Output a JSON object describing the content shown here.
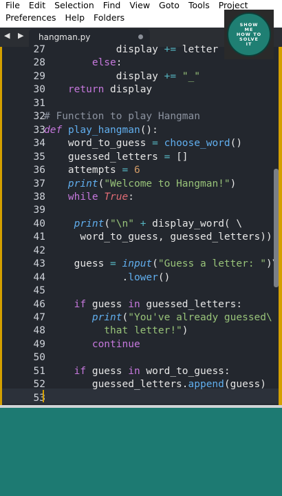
{
  "menu": {
    "row1": [
      "File",
      "Edit",
      "Selection",
      "Find",
      "View",
      "Goto",
      "Tools",
      "Project"
    ],
    "row2": [
      "Preferences",
      "Help",
      "Folders"
    ]
  },
  "logo": {
    "lines": [
      "SHOW",
      "ME",
      "HOW TO",
      "SOLVE",
      "IT"
    ]
  },
  "tab": {
    "nav": "◀ ▶",
    "title": "hangman.py"
  },
  "colors": {
    "accent": "#d4a000",
    "editor_bg": "#23272e",
    "bottom_bg": "#1d7a72"
  },
  "lines": [
    {
      "num": "27",
      "tokens": [
        {
          "t": "            display ",
          "c": "plain"
        },
        {
          "t": "+=",
          "c": "op"
        },
        {
          "t": " letter",
          "c": "plain"
        }
      ]
    },
    {
      "num": "28",
      "tokens": [
        {
          "t": "        else",
          "c": "kw"
        },
        {
          "t": ":",
          "c": "plain"
        }
      ]
    },
    {
      "num": "29",
      "tokens": [
        {
          "t": "            display ",
          "c": "plain"
        },
        {
          "t": "+=",
          "c": "op"
        },
        {
          "t": " ",
          "c": "plain"
        },
        {
          "t": "\"_\"",
          "c": "str"
        }
      ]
    },
    {
      "num": "30",
      "tokens": [
        {
          "t": "    return",
          "c": "kw"
        },
        {
          "t": " display",
          "c": "plain"
        }
      ]
    },
    {
      "num": "31",
      "tokens": []
    },
    {
      "num": "32",
      "tokens": [
        {
          "t": "# Function to play Hangman",
          "c": "cmt"
        }
      ]
    },
    {
      "num": "33",
      "tokens": [
        {
          "t": "def",
          "c": "def"
        },
        {
          "t": " ",
          "c": "plain"
        },
        {
          "t": "play_hangman",
          "c": "fn"
        },
        {
          "t": "():",
          "c": "plain"
        }
      ]
    },
    {
      "num": "34",
      "tokens": [
        {
          "t": "    word_to_guess ",
          "c": "plain"
        },
        {
          "t": "=",
          "c": "op"
        },
        {
          "t": " ",
          "c": "plain"
        },
        {
          "t": "choose_word",
          "c": "fn"
        },
        {
          "t": "()",
          "c": "plain"
        }
      ]
    },
    {
      "num": "35",
      "tokens": [
        {
          "t": "    guessed_letters ",
          "c": "plain"
        },
        {
          "t": "=",
          "c": "op"
        },
        {
          "t": " []",
          "c": "plain"
        }
      ]
    },
    {
      "num": "36",
      "tokens": [
        {
          "t": "    attempts ",
          "c": "plain"
        },
        {
          "t": "=",
          "c": "op"
        },
        {
          "t": " ",
          "c": "plain"
        },
        {
          "t": "6",
          "c": "num"
        }
      ]
    },
    {
      "num": "37",
      "tokens": [
        {
          "t": "    print",
          "c": "fnitalic"
        },
        {
          "t": "(",
          "c": "plain"
        },
        {
          "t": "\"Welcome to Hangman!\"",
          "c": "str"
        },
        {
          "t": ")",
          "c": "plain"
        }
      ]
    },
    {
      "num": "38",
      "tokens": [
        {
          "t": "    while",
          "c": "kw"
        },
        {
          "t": " ",
          "c": "plain"
        },
        {
          "t": "True",
          "c": "true"
        },
        {
          "t": ":",
          "c": "plain"
        }
      ]
    },
    {
      "num": "39",
      "tokens": []
    },
    {
      "num": "40",
      "tokens": [
        {
          "t": "     print",
          "c": "fnitalic"
        },
        {
          "t": "(",
          "c": "plain"
        },
        {
          "t": "\"\\n\"",
          "c": "str"
        },
        {
          "t": " ",
          "c": "plain"
        },
        {
          "t": "+",
          "c": "op"
        },
        {
          "t": " display_word( \\",
          "c": "plain"
        }
      ]
    },
    {
      "num": "41",
      "tokens": [
        {
          "t": "      word_to_guess, guessed_letters))",
          "c": "plain"
        }
      ]
    },
    {
      "num": "42",
      "tokens": []
    },
    {
      "num": "43",
      "tokens": [
        {
          "t": "     guess ",
          "c": "plain"
        },
        {
          "t": "=",
          "c": "op"
        },
        {
          "t": " ",
          "c": "plain"
        },
        {
          "t": "input",
          "c": "fnitalic"
        },
        {
          "t": "(",
          "c": "plain"
        },
        {
          "t": "\"Guess a letter: \"",
          "c": "str"
        },
        {
          "t": ")\\",
          "c": "plain"
        }
      ]
    },
    {
      "num": "44",
      "tokens": [
        {
          "t": "             .",
          "c": "plain"
        },
        {
          "t": "lower",
          "c": "fn"
        },
        {
          "t": "()",
          "c": "plain"
        }
      ]
    },
    {
      "num": "45",
      "tokens": []
    },
    {
      "num": "46",
      "tokens": [
        {
          "t": "     if",
          "c": "kw"
        },
        {
          "t": " guess ",
          "c": "plain"
        },
        {
          "t": "in",
          "c": "kw"
        },
        {
          "t": " guessed_letters:",
          "c": "plain"
        }
      ]
    },
    {
      "num": "47",
      "tokens": [
        {
          "t": "        print",
          "c": "fnitalic"
        },
        {
          "t": "(",
          "c": "plain"
        },
        {
          "t": "\"You've already guessed\\",
          "c": "str"
        }
      ]
    },
    {
      "num": "48",
      "tokens": [
        {
          "t": "          that letter!\"",
          "c": "str"
        },
        {
          "t": ")",
          "c": "plain"
        }
      ]
    },
    {
      "num": "49",
      "tokens": [
        {
          "t": "        continue",
          "c": "kw"
        }
      ]
    },
    {
      "num": "50",
      "tokens": []
    },
    {
      "num": "51",
      "tokens": [
        {
          "t": "     if",
          "c": "kw"
        },
        {
          "t": " guess ",
          "c": "plain"
        },
        {
          "t": "in",
          "c": "kw"
        },
        {
          "t": " word_to_guess:",
          "c": "plain"
        }
      ]
    },
    {
      "num": "52",
      "tokens": [
        {
          "t": "        guessed_letters.",
          "c": "plain"
        },
        {
          "t": "append",
          "c": "fn"
        },
        {
          "t": "(guess)",
          "c": "plain"
        }
      ]
    },
    {
      "num": "53",
      "tokens": []
    }
  ]
}
